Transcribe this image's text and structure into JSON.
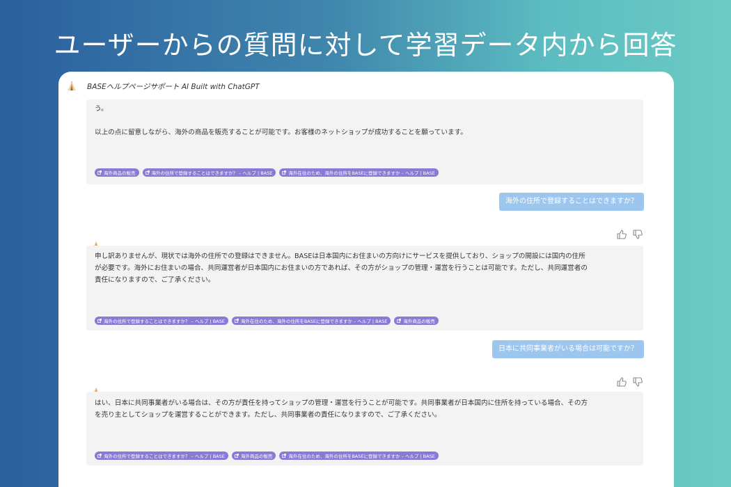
{
  "headline": "ユーザーからの質問に対して学習データ内から回答",
  "bot": {
    "name": "BASEヘルプページサポート AI Built with ChatGPT",
    "icon": "tent-icon"
  },
  "messages": [
    {
      "role": "assistant",
      "lines": [
        "う。",
        "",
        "以上の点に留意しながら、海外の商品を販売することが可能です。お客様のネットショップが成功することを願っています。"
      ],
      "sources": [
        "海外商品の販売",
        "海外の住所で登録することはできますか？ – ヘルプ | BASE",
        "海外在住のため、海外の住所をBASEに登録できますか – ヘルプ | BASE"
      ]
    },
    {
      "role": "user",
      "text": "海外の住所で登録することはできますか？"
    },
    {
      "role": "assistant",
      "lines": [
        "申し訳ありませんが、現状では海外の住所での登録はできません。BASEは日本国内にお住まいの方向けにサービスを提供しており、ショップの開設には国内の住所",
        "が必要です。海外にお住まいの場合、共同運営者が日本国内にお住まいの方であれば、その方がショップの管理・運営を行うことは可能です。ただし、共同運営者の",
        "責任になりますので、ご了承ください。"
      ],
      "sources": [
        "海外の住所で登録することはできますか？ – ヘルプ | BASE",
        "海外在住のため、海外の住所をBASEに登録できますか – ヘルプ | BASE",
        "海外商品の販売"
      ]
    },
    {
      "role": "user",
      "text": "日本に共同事業者がいる場合は可能ですか？"
    },
    {
      "role": "assistant",
      "lines": [
        "はい、日本に共同事業者がいる場合は、その方が責任を持ってショップの管理・運営を行うことが可能です。共同事業者が日本国内に住所を持っている場合、その方",
        "を売り主としてショップを運営することができます。ただし、共同事業者の責任になりますので、ご了承ください。"
      ],
      "sources": [
        "海外の住所で登録することはできますか？ – ヘルプ | BASE",
        "海外商品の販売",
        "海外在住のため、海外の住所をBASEに登録できますか – ヘルプ | BASE"
      ]
    }
  ],
  "feedback": {
    "like_icon": "thumbs-up-icon",
    "dislike_icon": "thumbs-down-icon"
  },
  "colors": {
    "gradient_start": "#2b5f9e",
    "gradient_end": "#6ccbc4",
    "chip": "#8b7ad4",
    "user_bubble": "#9cc6ee",
    "assistant_bubble": "#f3f3f3"
  }
}
